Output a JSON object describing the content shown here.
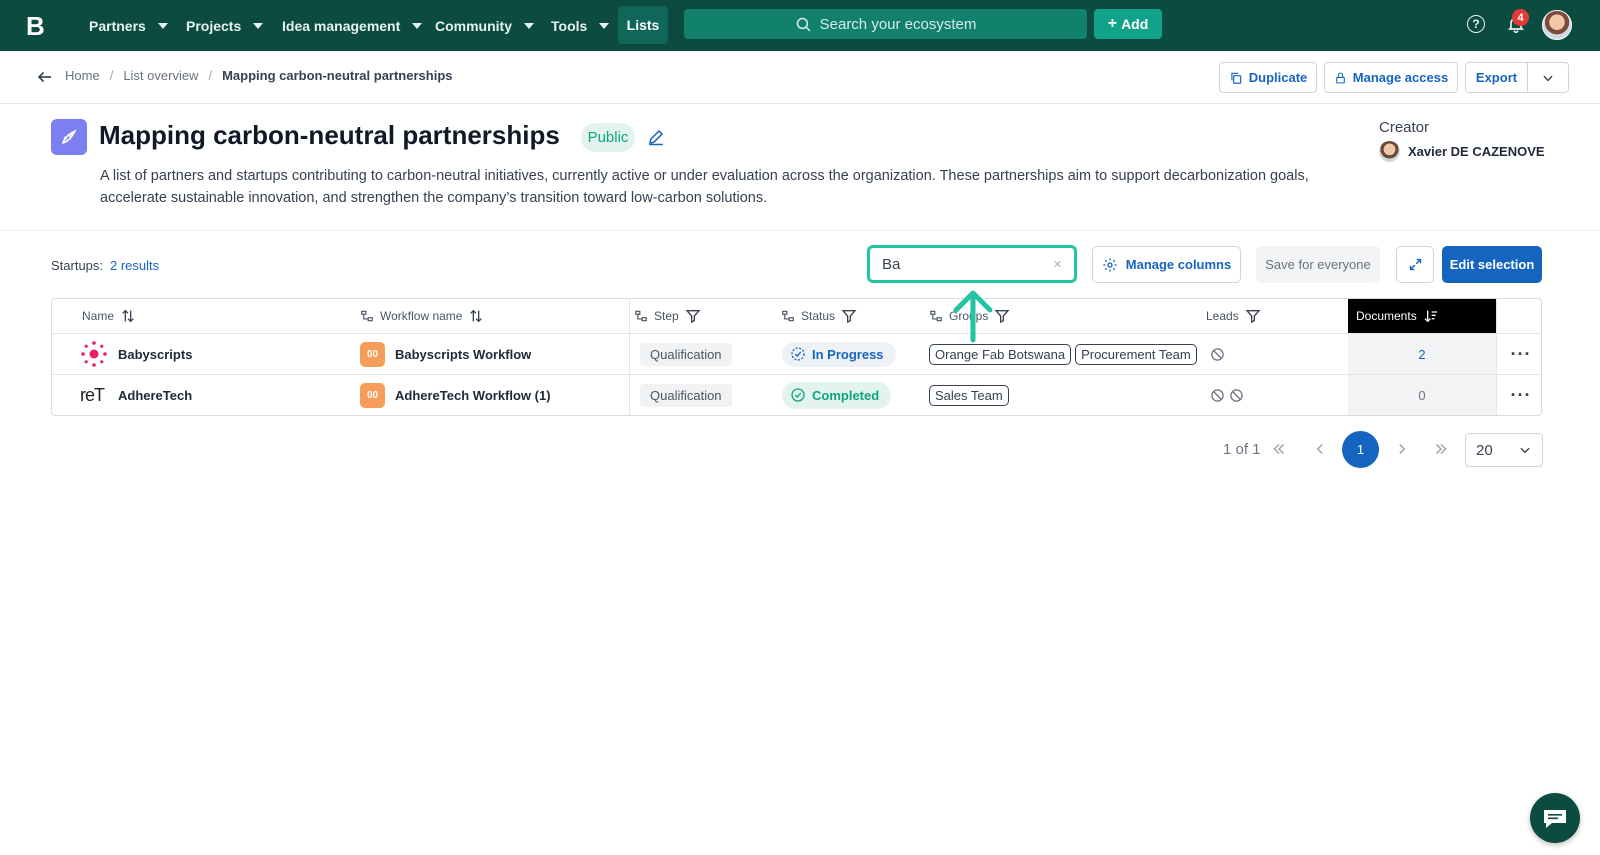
{
  "nav": {
    "logo": "B",
    "items": [
      {
        "label": "Partners"
      },
      {
        "label": "Projects"
      },
      {
        "label": "Idea management"
      },
      {
        "label": "Community"
      },
      {
        "label": "Tools"
      }
    ],
    "lists_label": "Lists",
    "search_placeholder": "Search your ecosystem",
    "add_label": "Add",
    "help_label": "?",
    "notification_count": "4"
  },
  "breadcrumb": {
    "home": "Home",
    "overview": "List overview",
    "current": "Mapping carbon-neutral partnerships",
    "sep": "/"
  },
  "actions": {
    "duplicate": "Duplicate",
    "manage_access": "Manage access",
    "export": "Export"
  },
  "list": {
    "title": "Mapping carbon-neutral partnerships",
    "visibility": "Public",
    "description": "A list of partners and startups contributing to carbon-neutral initiatives, currently active or under evaluation across the organization. These partnerships aim to support decarbonization goals, accelerate sustainable innovation, and strengthen the company’s transition toward low-carbon solutions.",
    "creator_label": "Creator",
    "creator_name": "Xavier DE CAZENOVE"
  },
  "toolbar": {
    "startups_label": "Startups:",
    "results": "2 results",
    "filter_value": "Ba",
    "clear": "×",
    "manage_columns": "Manage columns",
    "save_for_everyone": "Save for everyone",
    "edit_selection": "Edit selection"
  },
  "table": {
    "headers": {
      "name": "Name",
      "workflow": "Workflow name",
      "step": "Step",
      "status": "Status",
      "groups": "Groups",
      "leads": "Leads",
      "documents": "Documents"
    },
    "rows": [
      {
        "name": "Babyscripts",
        "logo_text": "",
        "workflow_icon": "00",
        "workflow": "Babyscripts Workflow",
        "step": "Qualification",
        "status": "In Progress",
        "groups": [
          "Orange Fab Botswana",
          "Procurement Team"
        ],
        "documents": "2"
      },
      {
        "name": "AdhereTech",
        "logo_text": "reT",
        "workflow_icon": "00",
        "workflow": "AdhereTech Workflow (1)",
        "step": "Qualification",
        "status": "Completed",
        "groups": [
          "Sales Team"
        ],
        "documents": "0"
      }
    ]
  },
  "pagination": {
    "summary": "1 of 1",
    "current_page": "1",
    "page_size": "20"
  },
  "colors": {
    "nav_bg": "#0c4b40",
    "primary": "#1565c0",
    "accent_green": "#10a37f",
    "highlight": "#22c4a1"
  }
}
